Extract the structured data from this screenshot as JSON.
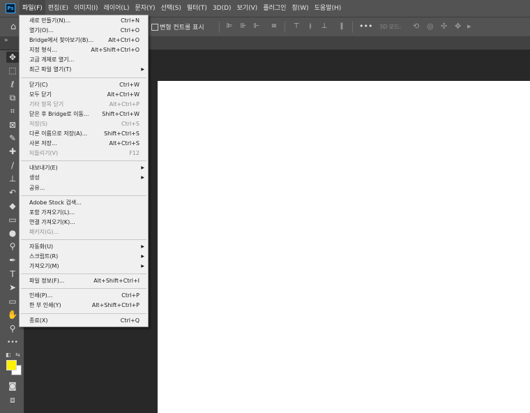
{
  "app": {
    "logo_text": "Ps"
  },
  "menubar": {
    "items": [
      "파일(F)",
      "편집(E)",
      "이미지(I)",
      "레이어(L)",
      "문자(Y)",
      "선택(S)",
      "필터(T)",
      "3D(D)",
      "보기(V)",
      "플러그인",
      "창(W)",
      "도움말(H)"
    ],
    "active_index": 0
  },
  "options_bar": {
    "transform_controls_label": "변형 컨트롤 표시",
    "transform_controls_checked": false,
    "mode_3d_label": "3D 모드:",
    "more_label": "•••"
  },
  "file_menu": {
    "groups": [
      [
        {
          "label": "새로 만들기(N)...",
          "shortcut": "Ctrl+N",
          "enabled": true,
          "submenu": false
        },
        {
          "label": "열기(O)...",
          "shortcut": "Ctrl+O",
          "enabled": true,
          "submenu": false
        },
        {
          "label": "Bridge에서 찾아보기(B)...",
          "shortcut": "Alt+Ctrl+O",
          "enabled": true,
          "submenu": false
        },
        {
          "label": "지정 형식...",
          "shortcut": "Alt+Shift+Ctrl+O",
          "enabled": true,
          "submenu": false
        },
        {
          "label": "고급 개체로 열기...",
          "shortcut": "",
          "enabled": true,
          "submenu": false
        },
        {
          "label": "최근 파일 열기(T)",
          "shortcut": "",
          "enabled": true,
          "submenu": true
        }
      ],
      [
        {
          "label": "닫기(C)",
          "shortcut": "Ctrl+W",
          "enabled": true,
          "submenu": false
        },
        {
          "label": "모두 닫기",
          "shortcut": "Alt+Ctrl+W",
          "enabled": true,
          "submenu": false
        },
        {
          "label": "기타 항목 닫기",
          "shortcut": "Alt+Ctrl+P",
          "enabled": false,
          "submenu": false
        },
        {
          "label": "닫은 후 Bridge로 이동...",
          "shortcut": "Shift+Ctrl+W",
          "enabled": true,
          "submenu": false
        },
        {
          "label": "저장(S)",
          "shortcut": "Ctrl+S",
          "enabled": false,
          "submenu": false
        },
        {
          "label": "다른 이름으로 저장(A)...",
          "shortcut": "Shift+Ctrl+S",
          "enabled": true,
          "submenu": false
        },
        {
          "label": "사본 저장...",
          "shortcut": "Alt+Ctrl+S",
          "enabled": true,
          "submenu": false
        },
        {
          "label": "되돌리기(V)",
          "shortcut": "F12",
          "enabled": false,
          "submenu": false
        }
      ],
      [
        {
          "label": "내보내기(E)",
          "shortcut": "",
          "enabled": true,
          "submenu": true
        },
        {
          "label": "생성",
          "shortcut": "",
          "enabled": true,
          "submenu": true
        },
        {
          "label": "공유...",
          "shortcut": "",
          "enabled": true,
          "submenu": false
        }
      ],
      [
        {
          "label": "Adobe Stock 검색...",
          "shortcut": "",
          "enabled": true,
          "submenu": false
        },
        {
          "label": "포함 가져오기(L)...",
          "shortcut": "",
          "enabled": true,
          "submenu": false
        },
        {
          "label": "연결 가져오기(K)...",
          "shortcut": "",
          "enabled": true,
          "submenu": false
        },
        {
          "label": "패키지(G)...",
          "shortcut": "",
          "enabled": false,
          "submenu": false
        }
      ],
      [
        {
          "label": "자동화(U)",
          "shortcut": "",
          "enabled": true,
          "submenu": true
        },
        {
          "label": "스크립트(R)",
          "shortcut": "",
          "enabled": true,
          "submenu": true
        },
        {
          "label": "가져오기(M)",
          "shortcut": "",
          "enabled": true,
          "submenu": true
        }
      ],
      [
        {
          "label": "파일 정보(F)...",
          "shortcut": "Alt+Shift+Ctrl+I",
          "enabled": true,
          "submenu": false
        }
      ],
      [
        {
          "label": "인쇄(P)...",
          "shortcut": "Ctrl+P",
          "enabled": true,
          "submenu": false
        },
        {
          "label": "한 부 인쇄(Y)",
          "shortcut": "Alt+Shift+Ctrl+P",
          "enabled": true,
          "submenu": false
        }
      ],
      [
        {
          "label": "종료(X)",
          "shortcut": "Ctrl+Q",
          "enabled": true,
          "submenu": false
        }
      ]
    ]
  },
  "toolbar": {
    "tools": [
      {
        "name": "move-tool-icon",
        "glyph": "✥"
      },
      {
        "name": "marquee-tool-icon",
        "glyph": "⬚"
      },
      {
        "name": "lasso-tool-icon",
        "glyph": "ℓ"
      },
      {
        "name": "object-select-tool-icon",
        "glyph": "⧉"
      },
      {
        "name": "crop-tool-icon",
        "glyph": "⌗"
      },
      {
        "name": "frame-tool-icon",
        "glyph": "⊠"
      },
      {
        "name": "eyedropper-tool-icon",
        "glyph": "✎"
      },
      {
        "name": "healing-brush-tool-icon",
        "glyph": "✚"
      },
      {
        "name": "brush-tool-icon",
        "glyph": "∕"
      },
      {
        "name": "clone-stamp-tool-icon",
        "glyph": "⊥"
      },
      {
        "name": "history-brush-tool-icon",
        "glyph": "↶"
      },
      {
        "name": "eraser-tool-icon",
        "glyph": "◆"
      },
      {
        "name": "gradient-tool-icon",
        "glyph": "▭"
      },
      {
        "name": "blur-tool-icon",
        "glyph": "●"
      },
      {
        "name": "dodge-tool-icon",
        "glyph": "⚲"
      },
      {
        "name": "pen-tool-icon",
        "glyph": "✒"
      },
      {
        "name": "type-tool-icon",
        "glyph": "T"
      },
      {
        "name": "path-select-tool-icon",
        "glyph": "➤"
      },
      {
        "name": "rectangle-tool-icon",
        "glyph": "▭"
      },
      {
        "name": "hand-tool-icon",
        "glyph": "✋"
      },
      {
        "name": "zoom-tool-icon",
        "glyph": "⚲"
      },
      {
        "name": "edit-toolbar-icon",
        "glyph": "•••"
      }
    ],
    "foreground_color": "#fff200",
    "background_color": "#ffffff"
  }
}
